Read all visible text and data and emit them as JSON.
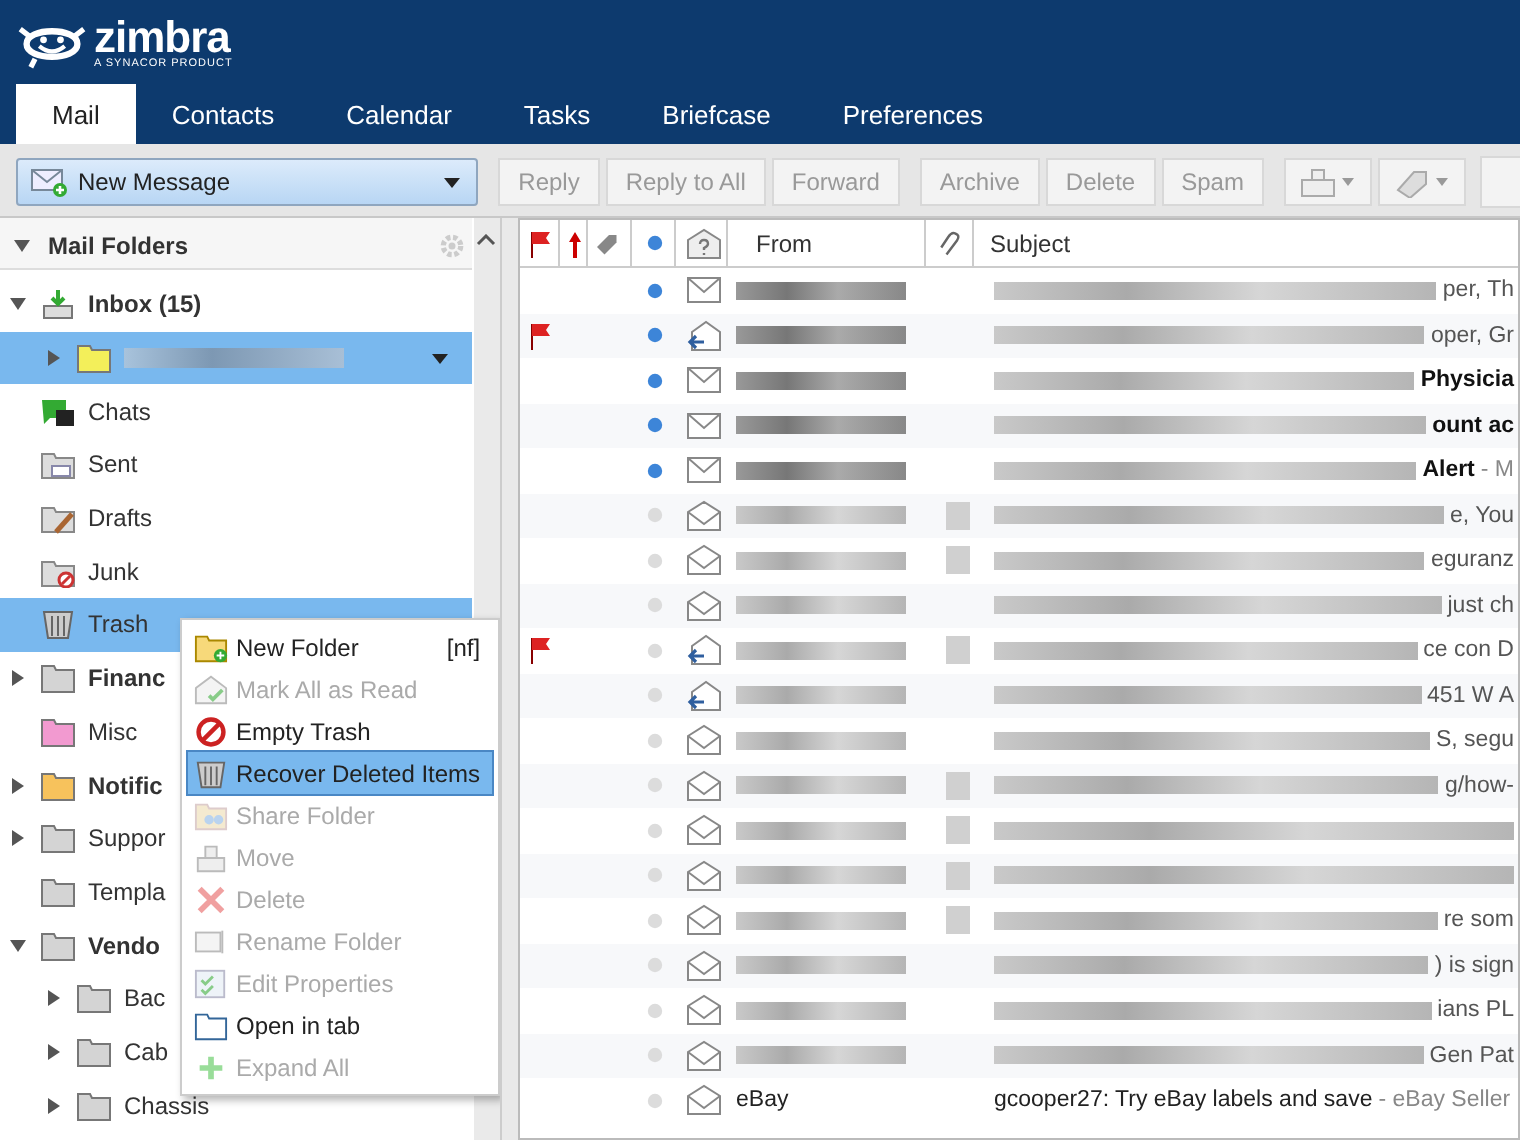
{
  "brand": {
    "name": "zimbra",
    "tagline": "A SYNACOR PRODUCT"
  },
  "tabs": [
    {
      "label": "Mail",
      "selected": true
    },
    {
      "label": "Contacts",
      "selected": false
    },
    {
      "label": "Calendar",
      "selected": false
    },
    {
      "label": "Tasks",
      "selected": false
    },
    {
      "label": "Briefcase",
      "selected": false
    },
    {
      "label": "Preferences",
      "selected": false
    }
  ],
  "toolbar": {
    "new_message": "New Message",
    "buttons": [
      {
        "label": "Reply",
        "disabled": true,
        "group_start": false
      },
      {
        "label": "Reply to All",
        "disabled": true,
        "group_start": false
      },
      {
        "label": "Forward",
        "disabled": true,
        "group_start": false
      },
      {
        "label": "Archive",
        "disabled": true,
        "group_start": true
      },
      {
        "label": "Delete",
        "disabled": true,
        "group_start": false
      },
      {
        "label": "Spam",
        "disabled": true,
        "group_start": false
      }
    ]
  },
  "sidebar": {
    "title": "Mail Folders",
    "folders": [
      {
        "label": "Inbox (15)",
        "kind": "inbox",
        "bold": true,
        "expanded": true,
        "selected": false,
        "children": [
          {
            "kind": "folder",
            "color": "#f3ef5a",
            "redacted": true,
            "expanded": false,
            "selected": true
          }
        ]
      },
      {
        "label": "Chats",
        "kind": "chats",
        "bold": false,
        "selected": false
      },
      {
        "label": "Sent",
        "kind": "sent",
        "bold": false,
        "selected": false
      },
      {
        "label": "Drafts",
        "kind": "drafts",
        "bold": false,
        "selected": false
      },
      {
        "label": "Junk",
        "kind": "junk",
        "bold": false,
        "selected": false
      },
      {
        "label": "Trash",
        "kind": "trash",
        "bold": false,
        "selected": true
      },
      {
        "label": "Financ",
        "kind": "folder",
        "color": "#d4d4d4",
        "bold": true,
        "expanded": false,
        "selected": false
      },
      {
        "label": "Misc",
        "kind": "folder",
        "color": "#f29ad0",
        "bold": false,
        "selected": false
      },
      {
        "label": "Notific",
        "kind": "folder",
        "color": "#f7c25c",
        "bold": true,
        "expanded": false,
        "selected": false
      },
      {
        "label": "Suppor",
        "kind": "folder",
        "color": "#d4d4d4",
        "bold": false,
        "expanded": false,
        "selected": false
      },
      {
        "label": "Templa",
        "kind": "folder",
        "color": "#d4d4d4",
        "bold": false,
        "selected": false
      },
      {
        "label": "Vendo",
        "kind": "folder",
        "color": "#d4d4d4",
        "bold": true,
        "expanded": true,
        "selected": false,
        "children": [
          {
            "label": "Bac",
            "kind": "folder",
            "color": "#d4d4d4",
            "expanded": false,
            "selected": false
          },
          {
            "label": "Cab",
            "kind": "folder",
            "color": "#d4d4d4",
            "expanded": false,
            "selected": false
          },
          {
            "label": "Chassis",
            "kind": "folder",
            "color": "#d4d4d4",
            "expanded": false,
            "selected": false
          }
        ]
      }
    ]
  },
  "context_menu": [
    {
      "label": "New Folder",
      "shortcut": "[nf]",
      "kind": "new-folder",
      "disabled": false,
      "selected": false
    },
    {
      "label": "Mark All as Read",
      "kind": "mark-read",
      "disabled": true,
      "selected": false
    },
    {
      "label": "Empty Trash",
      "kind": "empty",
      "disabled": false,
      "selected": false
    },
    {
      "label": "Recover Deleted Items",
      "kind": "trash",
      "disabled": false,
      "selected": true
    },
    {
      "label": "Share Folder",
      "kind": "share",
      "disabled": true,
      "selected": false
    },
    {
      "label": "Move",
      "kind": "move",
      "disabled": true,
      "selected": false
    },
    {
      "label": "Delete",
      "kind": "delete",
      "disabled": true,
      "selected": false
    },
    {
      "label": "Rename Folder",
      "kind": "rename",
      "disabled": true,
      "selected": false
    },
    {
      "label": "Edit Properties",
      "kind": "properties",
      "disabled": true,
      "selected": false
    },
    {
      "label": "Open in tab",
      "kind": "open-tab",
      "disabled": false,
      "selected": false
    },
    {
      "label": "Expand All",
      "kind": "expand",
      "disabled": true,
      "selected": false
    }
  ],
  "message_list": {
    "columns": {
      "from": "From",
      "subject": "Subject"
    },
    "rows": [
      {
        "flagged": false,
        "unread": true,
        "kind": "envelope",
        "attachment": false,
        "subject_tail": "per, Th",
        "tail_bold": false
      },
      {
        "flagged": true,
        "unread": true,
        "kind": "replied",
        "attachment": false,
        "subject_tail": "oper, Gr",
        "tail_bold": false
      },
      {
        "flagged": false,
        "unread": true,
        "kind": "envelope",
        "attachment": false,
        "subject_tail": "Physicia",
        "tail_bold": true
      },
      {
        "flagged": false,
        "unread": true,
        "kind": "envelope",
        "attachment": false,
        "subject_tail": "ount ac",
        "tail_bold": true
      },
      {
        "flagged": false,
        "unread": true,
        "kind": "envelope",
        "attachment": false,
        "subject_tail": "Alert",
        "tail_bold": true,
        "fragment": "- M"
      },
      {
        "flagged": false,
        "unread": false,
        "kind": "open",
        "attachment": true,
        "subject_tail": "e, You",
        "tail_bold": false
      },
      {
        "flagged": false,
        "unread": false,
        "kind": "open",
        "attachment": true,
        "subject_tail": "eguranz",
        "tail_bold": false
      },
      {
        "flagged": false,
        "unread": false,
        "kind": "open",
        "attachment": false,
        "subject_tail": "just ch",
        "tail_bold": false
      },
      {
        "flagged": true,
        "unread": false,
        "kind": "replied",
        "attachment": true,
        "subject_tail": "ce con D",
        "tail_bold": false
      },
      {
        "flagged": false,
        "unread": false,
        "kind": "replied",
        "attachment": false,
        "subject_tail": "451 W A",
        "tail_bold": false
      },
      {
        "flagged": false,
        "unread": false,
        "kind": "open",
        "attachment": false,
        "subject_tail": "S, segu",
        "tail_bold": false
      },
      {
        "flagged": false,
        "unread": false,
        "kind": "open",
        "attachment": true,
        "subject_tail": "g/how-",
        "tail_bold": false
      },
      {
        "flagged": false,
        "unread": false,
        "kind": "open",
        "attachment": true
      },
      {
        "flagged": false,
        "unread": false,
        "kind": "open",
        "attachment": true
      },
      {
        "flagged": false,
        "unread": false,
        "kind": "open",
        "attachment": true,
        "subject_tail": "re som",
        "tail_bold": false
      },
      {
        "flagged": false,
        "unread": false,
        "kind": "open",
        "attachment": false,
        "subject_tail": ") is sign",
        "tail_bold": false
      },
      {
        "flagged": false,
        "unread": false,
        "kind": "open",
        "attachment": false,
        "subject_tail": "ians PL",
        "tail_bold": false
      },
      {
        "flagged": false,
        "unread": false,
        "kind": "open",
        "attachment": false,
        "subject_tail": "Gen Pat",
        "tail_bold": false
      },
      {
        "flagged": false,
        "unread": false,
        "kind": "open",
        "attachment": false,
        "from": "eBay",
        "subject": "gcooper27: Try eBay labels and save",
        "fragment": "- eBay Seller"
      }
    ]
  }
}
